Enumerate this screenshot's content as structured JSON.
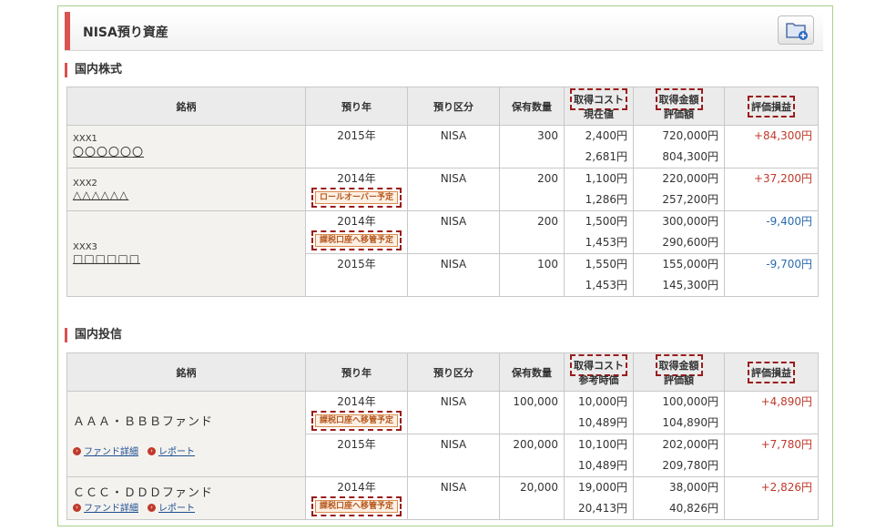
{
  "header": {
    "title": "NISA預り資産"
  },
  "domestic_stocks": {
    "title": "国内株式",
    "columns": {
      "name": "銘柄",
      "year": "預り年",
      "type": "預り区分",
      "qty": "保有数量",
      "cost": "取得コスト",
      "cost_sub": "現在値",
      "amount": "取得金額",
      "amount_sub": "評価額",
      "pl": "評価損益"
    },
    "rows": [
      {
        "code": "XXX1",
        "name": "〇〇〇〇〇〇",
        "year": "2015年",
        "type": "NISA",
        "qty": "300",
        "cost": "2,400円",
        "price": "2,681円",
        "acq": "720,000円",
        "val": "804,300円",
        "pl": "+84,300円"
      },
      {
        "code": "XXX2",
        "name": "△△△△△△",
        "year": "2014年",
        "badge": "ロールオーバー予定",
        "type": "NISA",
        "qty": "200",
        "cost": "1,100円",
        "price": "1,286円",
        "acq": "220,000円",
        "val": "257,200円",
        "pl": "+37,200円"
      },
      {
        "code": "XXX3",
        "name": "□□□□□□",
        "year": "2014年",
        "badge": "課税口座へ移管予定",
        "type": "NISA",
        "qty": "200",
        "cost": "1,500円",
        "price": "1,453円",
        "acq": "300,000円",
        "val": "290,600円",
        "pl": "-9,400円"
      },
      {
        "year": "2015年",
        "type": "NISA",
        "qty": "100",
        "cost": "1,550円",
        "price": "1,453円",
        "acq": "155,000円",
        "val": "145,300円",
        "pl": "-9,700円"
      }
    ]
  },
  "domestic_funds": {
    "title": "国内投信",
    "columns": {
      "name": "銘柄",
      "year": "預り年",
      "type": "預り区分",
      "qty": "保有数量",
      "cost": "取得コスト",
      "cost_sub": "参考時価",
      "amount": "取得金額",
      "amount_sub": "評価額",
      "pl": "評価損益"
    },
    "links": {
      "detail": "ファンド詳細",
      "report": "レポート"
    },
    "rows": [
      {
        "name": "ＡＡＡ・ＢＢＢファンド",
        "year": "2014年",
        "badge": "課税口座へ移管予定",
        "type": "NISA",
        "qty": "100,000",
        "cost": "10,000円",
        "price": "10,489円",
        "acq": "100,000円",
        "val": "104,890円",
        "pl": "+4,890円"
      },
      {
        "year": "2015年",
        "type": "NISA",
        "qty": "200,000",
        "cost": "10,100円",
        "price": "10,489円",
        "acq": "202,000円",
        "val": "209,780円",
        "pl": "+7,780円"
      },
      {
        "name": "ＣＣＣ・ＤＤＤファンド",
        "year": "2014年",
        "badge": "課税口座へ移管予定",
        "type": "NISA",
        "qty": "20,000",
        "cost": "19,000円",
        "price": "20,413円",
        "acq": "38,000円",
        "val": "40,826円",
        "pl": "+2,826円"
      }
    ]
  },
  "colors": {
    "positive": "#c0392b",
    "negative": "#2b6cb0",
    "accent": "#d9534f"
  }
}
